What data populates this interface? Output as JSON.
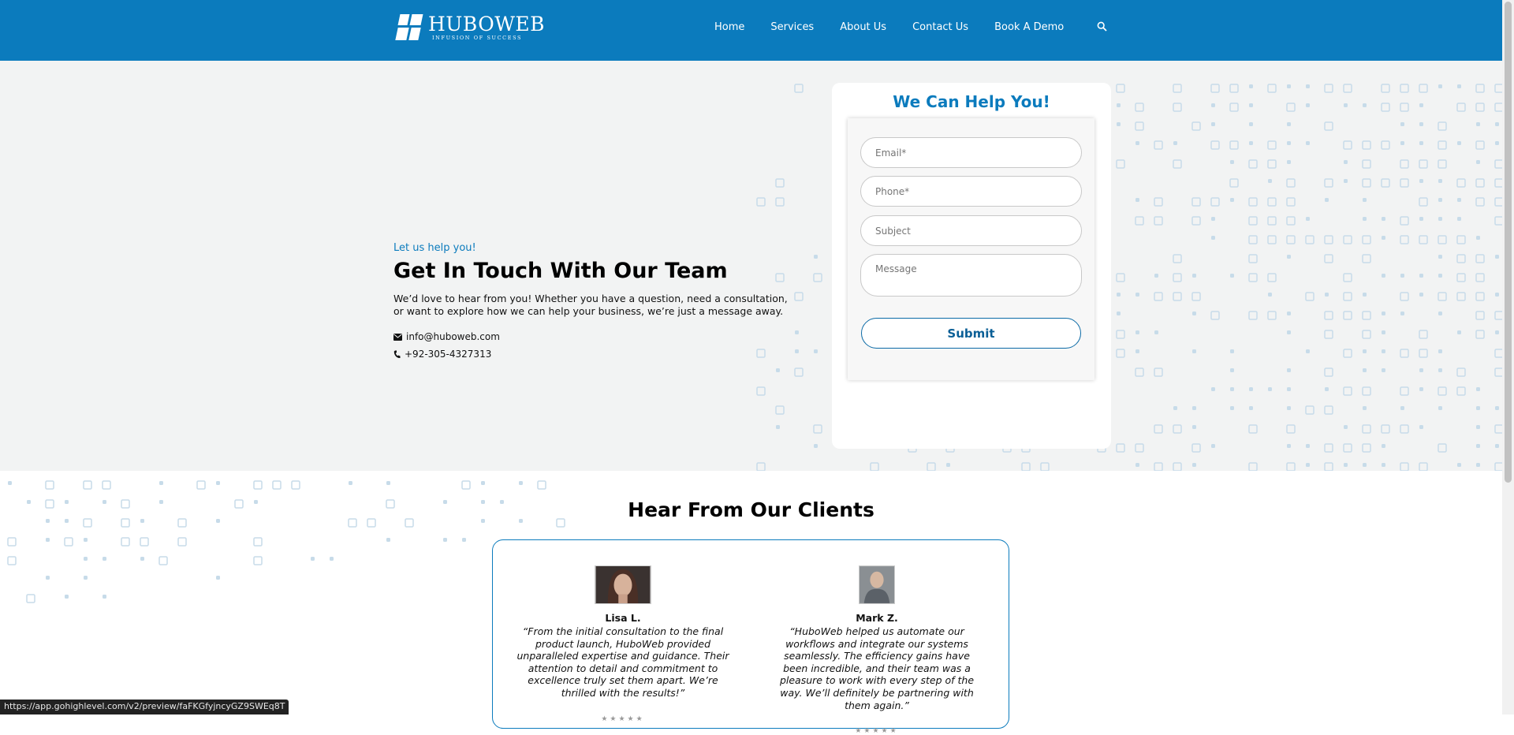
{
  "nav": {
    "logo_name": "HUBOWEB",
    "logo_tagline": "INFUSION OF SUCCESS",
    "items": [
      {
        "label": "Home"
      },
      {
        "label": "Services"
      },
      {
        "label": "About Us"
      },
      {
        "label": "Contact Us"
      },
      {
        "label": "Book A Demo"
      }
    ],
    "search_icon": "search-icon"
  },
  "hero": {
    "kicker": "Let us help you!",
    "headline": "Get In Touch With Our Team",
    "intro": "We’d love to hear from you! Whether you have a question, need a consultation, or want to explore how we can help your business, we’re just a message away.",
    "email": "info@huboweb.com",
    "phone": "+92-305-4327313"
  },
  "form": {
    "title": "We Can Help You!",
    "email_placeholder": "Email*",
    "phone_placeholder": "Phone*",
    "subject_placeholder": "Subject",
    "message_placeholder": "Message",
    "submit_label": "Submit"
  },
  "testimonials": {
    "title": "Hear From Our Clients",
    "items": [
      {
        "name": "Lisa L.",
        "quote": "“From the initial consultation to the final product launch, HuboWeb provided unparalleled expertise and guidance. Their attention to detail and commitment to excellence truly set them apart. We’re thrilled with the results!”"
      },
      {
        "name": "Mark Z.",
        "quote": "“HuboWeb helped us automate our workflows and integrate our systems seamlessly. The efficiency gains have been incredible, and their team was a pleasure to work with every step of the way. We’ll definitely be partnering with them again.”"
      }
    ]
  },
  "status_bar": {
    "url": "https://app.gohighlevel.com/v2/preview/faFKGfyjncyGZ9SWEq8T"
  },
  "colors": {
    "brand_blue": "#0b7bbd",
    "hero_bg": "#f2f3f3"
  }
}
